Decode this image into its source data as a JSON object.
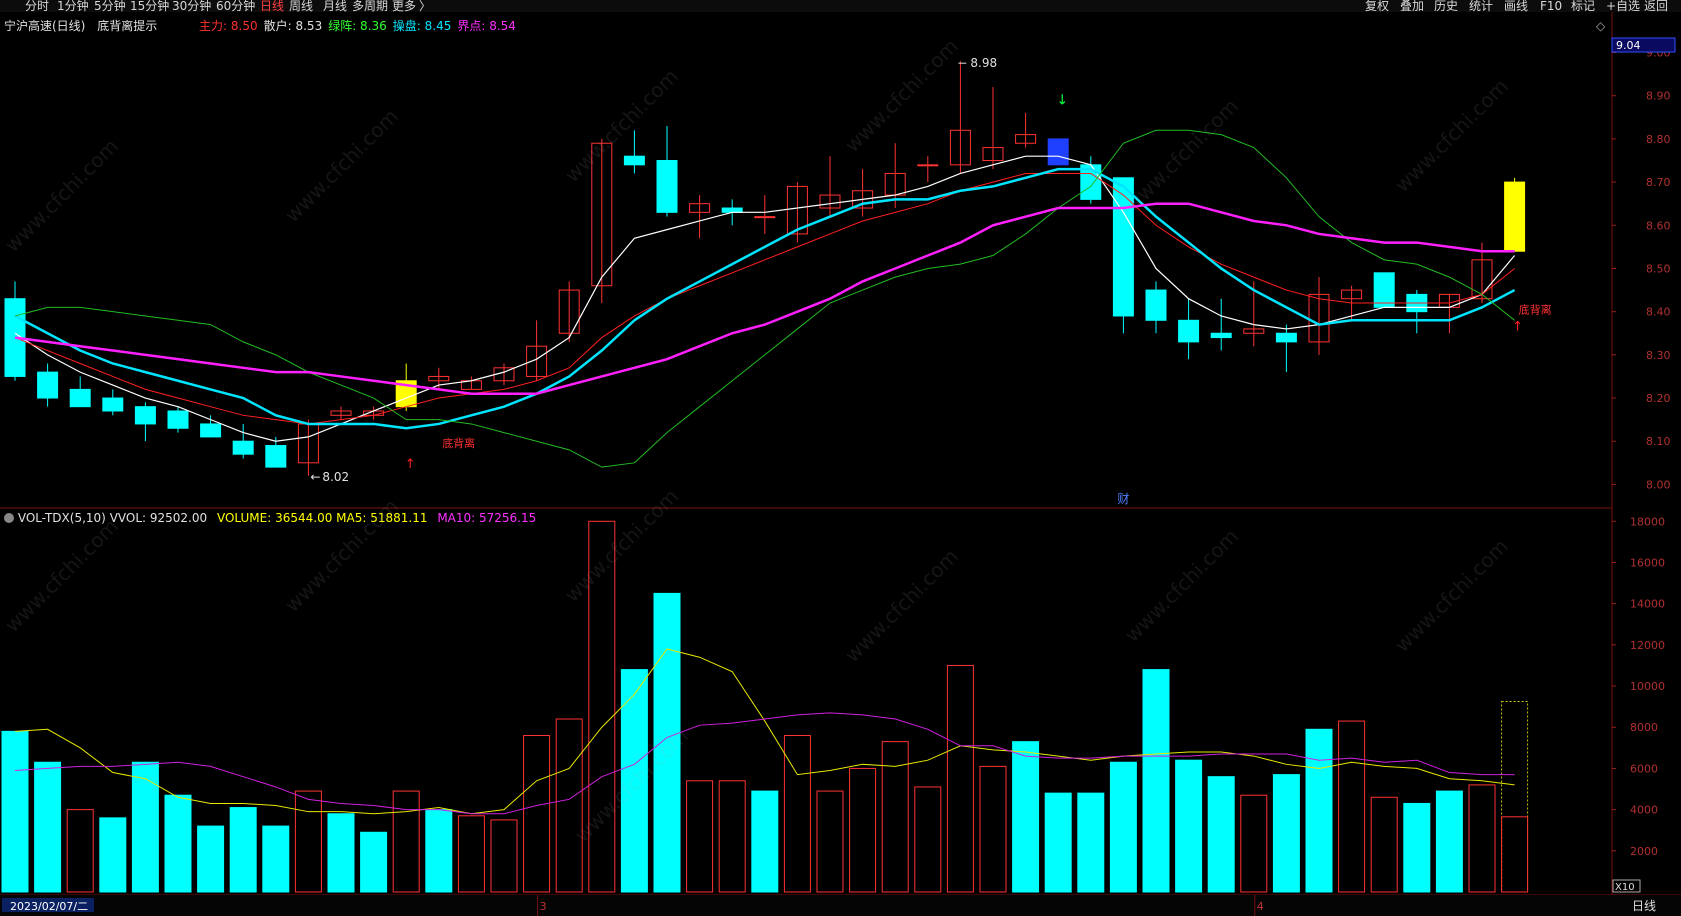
{
  "toolbar": {
    "left": [
      {
        "label": "分时",
        "active": false
      },
      {
        "label": "1分钟",
        "active": false
      },
      {
        "label": "5分钟",
        "active": false
      },
      {
        "label": "15分钟",
        "active": false
      },
      {
        "label": "30分钟",
        "active": false
      },
      {
        "label": "60分钟",
        "active": false
      },
      {
        "label": "日线",
        "active": true
      },
      {
        "label": "周线",
        "active": false
      },
      {
        "label": "月线",
        "active": false
      },
      {
        "label": "多周期",
        "active": false
      },
      {
        "label": "更多",
        "active": false
      }
    ],
    "more_arrow": "〉",
    "right": [
      "复权",
      "叠加",
      "历史",
      "统计",
      "画线",
      "F10",
      "标记",
      "+自选",
      "返回"
    ]
  },
  "price_panel": {
    "stock_name": "宁沪高速(日线)",
    "indicator_name": "底背离提示",
    "indicators": [
      {
        "label": "主力:",
        "value": "8.50",
        "color": "#ff3030"
      },
      {
        "label": "散户:",
        "value": "8.53",
        "color": "#e0e0e0"
      },
      {
        "label": "绿阵:",
        "value": "8.36",
        "color": "#30ff30"
      },
      {
        "label": "操盘:",
        "value": "8.45",
        "color": "#00e5ff"
      },
      {
        "label": "界点:",
        "value": "8.54",
        "color": "#ff30ff"
      }
    ],
    "current_price": "9.04",
    "high_label": "8.98",
    "low_label": "8.02",
    "signal_text": "底背离",
    "event_marker": "财",
    "corner_icon": "◇"
  },
  "volume_panel": {
    "title": "VOL-TDX(5,10)",
    "vvol": "VVOL: 92502.00",
    "volume": "VOLUME: 36544.00",
    "ma5": "MA5: 51881.11",
    "ma10": "MA10: 57256.15",
    "scale_label": "X10"
  },
  "bottom": {
    "date": "2023/02/07/二",
    "month_3": "3",
    "month_4": "4",
    "period": "日线"
  },
  "watermark": "www.cfchi.com",
  "colors": {
    "up": "#ff3232",
    "down": "#00ffff",
    "ma_white": "#ffffff",
    "ma_red": "#ff2020",
    "ma_green": "#22bb22",
    "ma_cyan": "#00e5ff",
    "ma_magenta": "#ff20ff",
    "yellow": "#ffff00",
    "grid": "#7a1010"
  },
  "chart_data": [
    {
      "type": "candlestick",
      "title": "宁沪高速(日线)",
      "ylim": [
        7.95,
        9.08
      ],
      "yticks": [
        8.0,
        8.1,
        8.2,
        8.3,
        8.4,
        8.5,
        8.6,
        8.7,
        8.8,
        8.9,
        9.0
      ],
      "candles": [
        {
          "o": 8.43,
          "h": 8.47,
          "l": 8.24,
          "c": 8.25
        },
        {
          "o": 8.26,
          "h": 8.28,
          "l": 8.18,
          "c": 8.2
        },
        {
          "o": 8.22,
          "h": 8.25,
          "l": 8.18,
          "c": 8.18
        },
        {
          "o": 8.2,
          "h": 8.22,
          "l": 8.16,
          "c": 8.17
        },
        {
          "o": 8.18,
          "h": 8.19,
          "l": 8.1,
          "c": 8.14
        },
        {
          "o": 8.17,
          "h": 8.18,
          "l": 8.12,
          "c": 8.13
        },
        {
          "o": 8.14,
          "h": 8.16,
          "l": 8.11,
          "c": 8.11
        },
        {
          "o": 8.1,
          "h": 8.14,
          "l": 8.06,
          "c": 8.07
        },
        {
          "o": 8.09,
          "h": 8.11,
          "l": 8.04,
          "c": 8.04
        },
        {
          "o": 8.05,
          "h": 8.15,
          "l": 8.02,
          "c": 8.14
        },
        {
          "o": 8.16,
          "h": 8.18,
          "l": 8.15,
          "c": 8.17
        },
        {
          "o": 8.16,
          "h": 8.18,
          "l": 8.15,
          "c": 8.17
        },
        {
          "o": 8.18,
          "h": 8.28,
          "l": 8.17,
          "c": 8.24,
          "highlight": true
        },
        {
          "o": 8.24,
          "h": 8.27,
          "l": 8.22,
          "c": 8.25
        },
        {
          "o": 8.22,
          "h": 8.25,
          "l": 8.22,
          "c": 8.24
        },
        {
          "o": 8.24,
          "h": 8.28,
          "l": 8.23,
          "c": 8.27
        },
        {
          "o": 8.25,
          "h": 8.38,
          "l": 8.24,
          "c": 8.32
        },
        {
          "o": 8.35,
          "h": 8.47,
          "l": 8.33,
          "c": 8.45
        },
        {
          "o": 8.46,
          "h": 8.8,
          "l": 8.42,
          "c": 8.79
        },
        {
          "o": 8.76,
          "h": 8.82,
          "l": 8.72,
          "c": 8.74
        },
        {
          "o": 8.75,
          "h": 8.83,
          "l": 8.62,
          "c": 8.63
        },
        {
          "o": 8.63,
          "h": 8.67,
          "l": 8.57,
          "c": 8.65
        },
        {
          "o": 8.64,
          "h": 8.66,
          "l": 8.6,
          "c": 8.63
        },
        {
          "o": 8.62,
          "h": 8.67,
          "l": 8.58,
          "c": 8.62
        },
        {
          "o": 8.58,
          "h": 8.7,
          "l": 8.56,
          "c": 8.69
        },
        {
          "o": 8.64,
          "h": 8.76,
          "l": 8.62,
          "c": 8.67
        },
        {
          "o": 8.64,
          "h": 8.73,
          "l": 8.62,
          "c": 8.68
        },
        {
          "o": 8.67,
          "h": 8.79,
          "l": 8.64,
          "c": 8.72
        },
        {
          "o": 8.74,
          "h": 8.76,
          "l": 8.7,
          "c": 8.74
        },
        {
          "o": 8.74,
          "h": 8.98,
          "l": 8.72,
          "c": 8.82
        },
        {
          "o": 8.75,
          "h": 8.92,
          "l": 8.73,
          "c": 8.78
        },
        {
          "o": 8.79,
          "h": 8.86,
          "l": 8.78,
          "c": 8.81
        },
        {
          "o": 8.8,
          "h": 8.8,
          "l": 8.74,
          "c": 8.74,
          "highlight_down": true
        },
        {
          "o": 8.74,
          "h": 8.76,
          "l": 8.65,
          "c": 8.66
        },
        {
          "o": 8.71,
          "h": 8.71,
          "l": 8.35,
          "c": 8.39
        },
        {
          "o": 8.45,
          "h": 8.47,
          "l": 8.35,
          "c": 8.38
        },
        {
          "o": 8.38,
          "h": 8.43,
          "l": 8.29,
          "c": 8.33
        },
        {
          "o": 8.35,
          "h": 8.43,
          "l": 8.31,
          "c": 8.34
        },
        {
          "o": 8.35,
          "h": 8.47,
          "l": 8.32,
          "c": 8.36
        },
        {
          "o": 8.35,
          "h": 8.37,
          "l": 8.26,
          "c": 8.33
        },
        {
          "o": 8.33,
          "h": 8.48,
          "l": 8.3,
          "c": 8.44
        },
        {
          "o": 8.43,
          "h": 8.46,
          "l": 8.38,
          "c": 8.45
        },
        {
          "o": 8.49,
          "h": 8.49,
          "l": 8.41,
          "c": 8.41
        },
        {
          "o": 8.44,
          "h": 8.45,
          "l": 8.35,
          "c": 8.4
        },
        {
          "o": 8.41,
          "h": 8.44,
          "l": 8.35,
          "c": 8.44
        },
        {
          "o": 8.52,
          "h": 8.56,
          "l": 8.42,
          "c": 8.43,
          "color_up": true
        },
        {
          "o": 8.54,
          "h": 8.71,
          "l": 8.54,
          "c": 8.7,
          "highlight": true
        }
      ],
      "series": [
        {
          "name": "白线",
          "values": [
            8.35,
            8.3,
            8.26,
            8.23,
            8.2,
            8.18,
            8.15,
            8.12,
            8.1,
            8.11,
            8.14,
            8.17,
            8.2,
            8.23,
            8.24,
            8.26,
            8.29,
            8.34,
            8.48,
            8.57,
            8.59,
            8.61,
            8.63,
            8.63,
            8.64,
            8.65,
            8.66,
            8.67,
            8.69,
            8.72,
            8.74,
            8.76,
            8.76,
            8.74,
            8.63,
            8.5,
            8.43,
            8.39,
            8.37,
            8.36,
            8.37,
            8.39,
            8.41,
            8.41,
            8.41,
            8.44,
            8.53
          ]
        },
        {
          "name": "红线",
          "values": [
            8.34,
            8.31,
            8.28,
            8.25,
            8.22,
            8.2,
            8.18,
            8.16,
            8.15,
            8.14,
            8.15,
            8.16,
            8.18,
            8.2,
            8.21,
            8.22,
            8.24,
            8.27,
            8.34,
            8.39,
            8.43,
            8.46,
            8.49,
            8.52,
            8.55,
            8.58,
            8.61,
            8.63,
            8.65,
            8.68,
            8.7,
            8.72,
            8.72,
            8.72,
            8.67,
            8.6,
            8.55,
            8.51,
            8.48,
            8.45,
            8.43,
            8.42,
            8.42,
            8.42,
            8.42,
            8.44,
            8.5
          ]
        },
        {
          "name": "青线",
          "values": [
            8.39,
            8.35,
            8.31,
            8.28,
            8.26,
            8.24,
            8.22,
            8.2,
            8.16,
            8.14,
            8.14,
            8.14,
            8.13,
            8.14,
            8.16,
            8.18,
            8.21,
            8.25,
            8.31,
            8.38,
            8.43,
            8.47,
            8.51,
            8.55,
            8.59,
            8.62,
            8.65,
            8.66,
            8.66,
            8.68,
            8.69,
            8.71,
            8.73,
            8.73,
            8.69,
            8.62,
            8.56,
            8.5,
            8.45,
            8.41,
            8.37,
            8.38,
            8.38,
            8.38,
            8.38,
            8.41,
            8.45
          ]
        },
        {
          "name": "绿线",
          "values": [
            8.39,
            8.41,
            8.41,
            8.4,
            8.39,
            8.38,
            8.37,
            8.33,
            8.3,
            8.26,
            8.23,
            8.2,
            8.15,
            8.15,
            8.14,
            8.12,
            8.1,
            8.08,
            8.04,
            8.05,
            8.12,
            8.18,
            8.24,
            8.3,
            8.36,
            8.42,
            8.45,
            8.48,
            8.5,
            8.51,
            8.53,
            8.58,
            8.64,
            8.69,
            8.79,
            8.82,
            8.82,
            8.81,
            8.78,
            8.71,
            8.62,
            8.56,
            8.52,
            8.51,
            8.48,
            8.44,
            8.38
          ]
        },
        {
          "name": "紫线",
          "values": [
            8.34,
            8.33,
            8.32,
            8.31,
            8.3,
            8.29,
            8.28,
            8.27,
            8.26,
            8.26,
            8.25,
            8.24,
            8.23,
            8.22,
            8.21,
            8.21,
            8.21,
            8.23,
            8.25,
            8.27,
            8.29,
            8.32,
            8.35,
            8.37,
            8.4,
            8.43,
            8.47,
            8.5,
            8.53,
            8.56,
            8.6,
            8.62,
            8.64,
            8.64,
            8.64,
            8.65,
            8.65,
            8.63,
            8.61,
            8.6,
            8.58,
            8.57,
            8.56,
            8.56,
            8.55,
            8.54,
            8.54
          ]
        }
      ]
    },
    {
      "type": "bar",
      "title": "VOL-TDX(5,10)",
      "ylim": [
        0,
        18500
      ],
      "yticks": [
        2000,
        4000,
        6000,
        8000,
        10000,
        12000,
        14000,
        16000,
        18000
      ],
      "values": [
        7800,
        6300,
        4000,
        3600,
        6300,
        4700,
        3200,
        4100,
        3200,
        4900,
        3800,
        2900,
        4900,
        4000,
        3700,
        3500,
        7600,
        8400,
        18000,
        10800,
        14500,
        5400,
        5400,
        4900,
        7600,
        4900,
        6000,
        7300,
        5100,
        11000,
        6100,
        7300,
        4800,
        4800,
        6300,
        10800,
        6400,
        5600,
        4700,
        5700,
        7900,
        8300,
        4600,
        4300,
        4900,
        5200,
        7900
      ],
      "updown": [
        0,
        0,
        1,
        0,
        0,
        0,
        0,
        0,
        0,
        1,
        0,
        0,
        1,
        0,
        1,
        1,
        1,
        1,
        1,
        0,
        0,
        1,
        1,
        0,
        1,
        1,
        1,
        1,
        1,
        1,
        1,
        0,
        0,
        0,
        0,
        0,
        0,
        0,
        1,
        0,
        0,
        1,
        1,
        0,
        0,
        1,
        1
      ],
      "last_partial": 3650,
      "last_projected": 9250,
      "series": [
        {
          "name": "MA5",
          "values": [
            7800,
            7900,
            7000,
            5800,
            5500,
            4600,
            4300,
            4300,
            4200,
            3900,
            3900,
            3800,
            3900,
            4100,
            3800,
            4000,
            5400,
            6000,
            8000,
            9600,
            11800,
            11400,
            10700,
            8300,
            5700,
            5900,
            6200,
            6100,
            6400,
            7100,
            6900,
            6800,
            6600,
            6400,
            6600,
            6700,
            6800,
            6800,
            6600,
            6200,
            6000,
            6300,
            6100,
            6000,
            5500,
            5400,
            5200
          ]
        },
        {
          "name": "MA10",
          "values": [
            5900,
            6000,
            6100,
            6100,
            6200,
            6300,
            6100,
            5600,
            5100,
            4500,
            4300,
            4200,
            4000,
            4000,
            3800,
            3800,
            4200,
            4500,
            5600,
            6200,
            7500,
            8100,
            8200,
            8400,
            8600,
            8700,
            8600,
            8400,
            7900,
            7100,
            7100,
            6600,
            6500,
            6500,
            6600,
            6600,
            6600,
            6700,
            6700,
            6700,
            6400,
            6500,
            6300,
            6400,
            5800,
            5700,
            5700
          ]
        }
      ]
    }
  ]
}
